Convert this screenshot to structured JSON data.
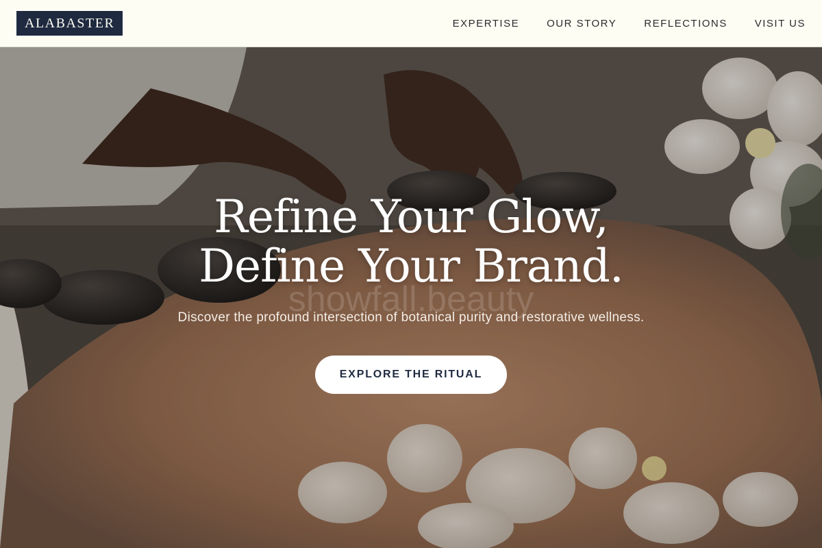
{
  "brand": {
    "logo_text": "ALABASTER"
  },
  "nav": {
    "items": [
      {
        "label": "EXPERTISE"
      },
      {
        "label": "OUR STORY"
      },
      {
        "label": "REFLECTIONS"
      },
      {
        "label": "VISIT US"
      }
    ]
  },
  "hero": {
    "headline_line1": "Refine Your Glow,",
    "headline_line2": "Define Your Brand.",
    "watermark": "showfall.beauty",
    "subtitle": "Discover the profound intersection of botanical purity and restorative wellness.",
    "cta_label": "EXPLORE THE RITUAL"
  },
  "colors": {
    "header_bg": "#fefdf4",
    "logo_bg": "#1f2a40",
    "cta_text": "#1f2a40"
  }
}
